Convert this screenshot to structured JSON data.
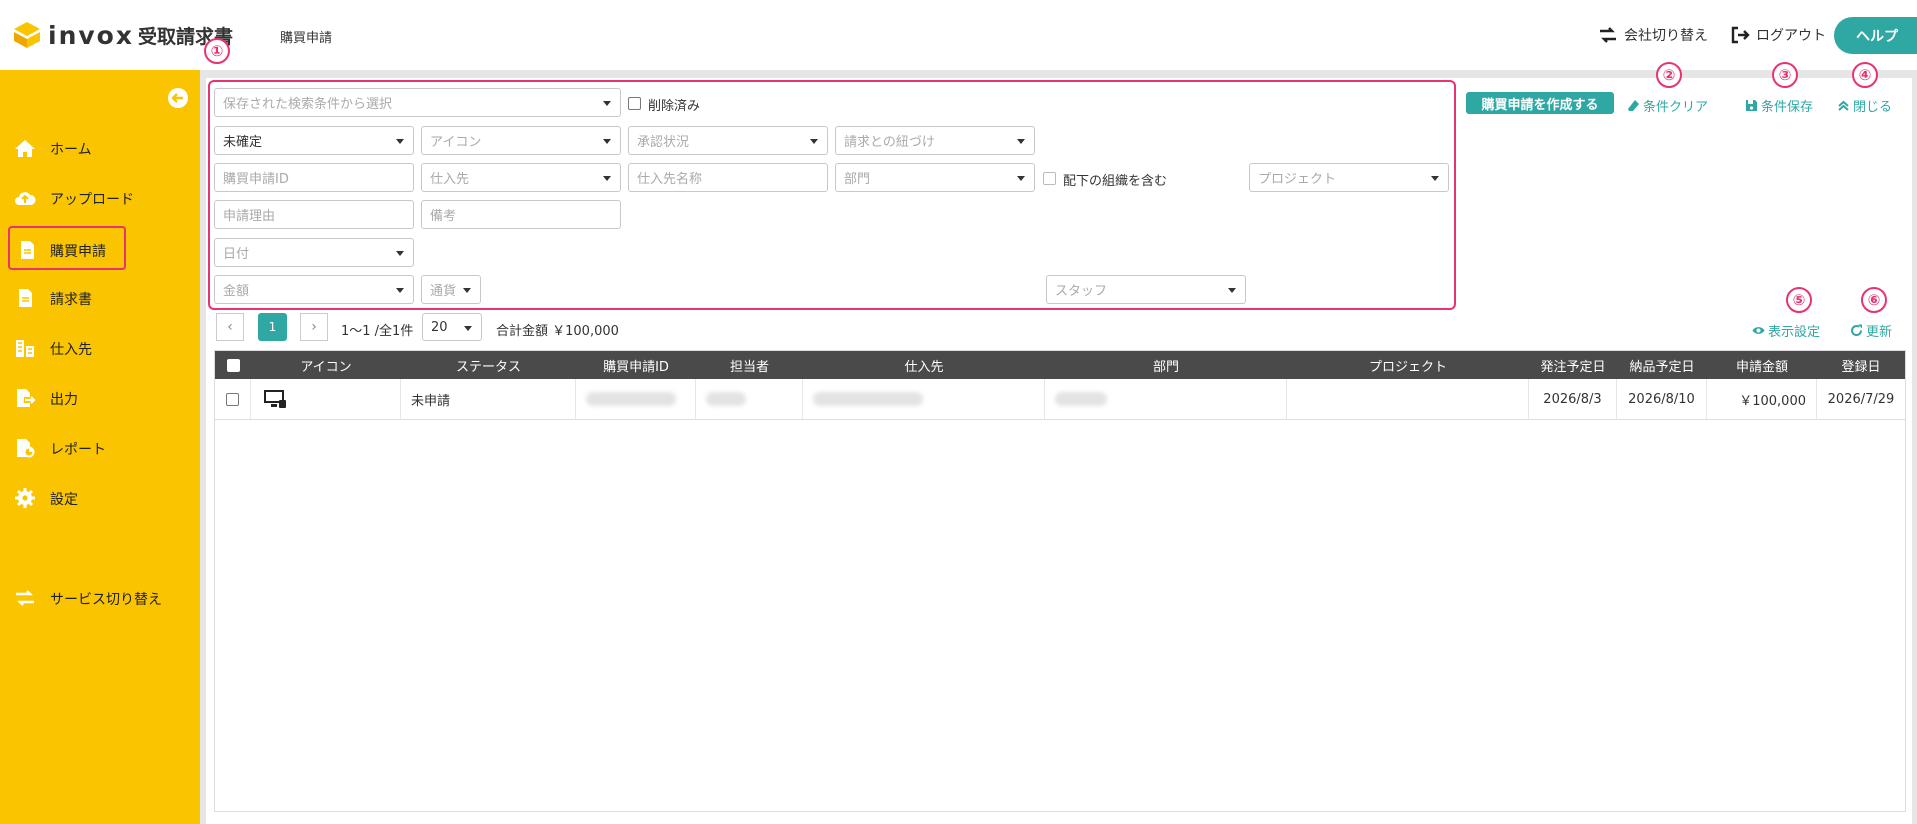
{
  "header": {
    "logo_text": "invox",
    "logo_sub": "受取請求書",
    "breadcrumb": "購買申請",
    "switch_company": "会社切り替え",
    "logout": "ログアウト",
    "help": "ヘルプ"
  },
  "sidebar": {
    "items": [
      {
        "label": "ホーム",
        "icon": "home-icon"
      },
      {
        "label": "アップロード",
        "icon": "cloud-upload-icon"
      },
      {
        "label": "購買申請",
        "icon": "document-icon"
      },
      {
        "label": "請求書",
        "icon": "invoice-icon"
      },
      {
        "label": "仕入先",
        "icon": "building-icon"
      },
      {
        "label": "出力",
        "icon": "export-icon"
      },
      {
        "label": "レポート",
        "icon": "report-icon"
      },
      {
        "label": "設定",
        "icon": "gear-icon"
      },
      {
        "label": "サービス切り替え",
        "icon": "swap-icon"
      }
    ]
  },
  "filters": {
    "saved_search_placeholder": "保存された検索条件から選択",
    "deleted_label": "削除済み",
    "status_value": "未確定",
    "icon_placeholder": "アイコン",
    "approval_placeholder": "承認状況",
    "invoice_link_placeholder": "請求との紐づけ",
    "request_id_placeholder": "購買申請ID",
    "supplier_placeholder": "仕入先",
    "supplier_name_placeholder": "仕入先名称",
    "department_placeholder": "部門",
    "include_sub_label": "配下の組織を含む",
    "project_placeholder": "プロジェクト",
    "reason_placeholder": "申請理由",
    "note_placeholder": "備考",
    "date_placeholder": "日付",
    "amount_placeholder": "金額",
    "currency_placeholder": "通貨",
    "staff_placeholder": "スタッフ"
  },
  "actions": {
    "create": "購買申請を作成する",
    "clear": "条件クリア",
    "save": "条件保存",
    "close": "閉じる",
    "display_settings": "表示設定",
    "refresh": "更新"
  },
  "annotations": [
    "①",
    "②",
    "③",
    "④",
    "⑤",
    "⑥"
  ],
  "pagination": {
    "current_page": "1",
    "range_text": "1〜1 /全1件",
    "per_page": "20",
    "total_label": "合計金額 ￥100,000"
  },
  "table": {
    "columns": [
      "アイコン",
      "ステータス",
      "購買申請ID",
      "担当者",
      "仕入先",
      "部門",
      "プロジェクト",
      "発注予定日",
      "納品予定日",
      "申請金額",
      "登録日"
    ],
    "rows": [
      {
        "status": "未申請",
        "order_date": "2026/8/3",
        "delivery_date": "2026/8/10",
        "amount": "￥100,000",
        "registered": "2026/7/29"
      }
    ]
  },
  "colors": {
    "sidebar": "#fbc400",
    "accent": "#2fa8a3",
    "highlight": "#e8346e",
    "table_header": "#4a4a4a"
  }
}
